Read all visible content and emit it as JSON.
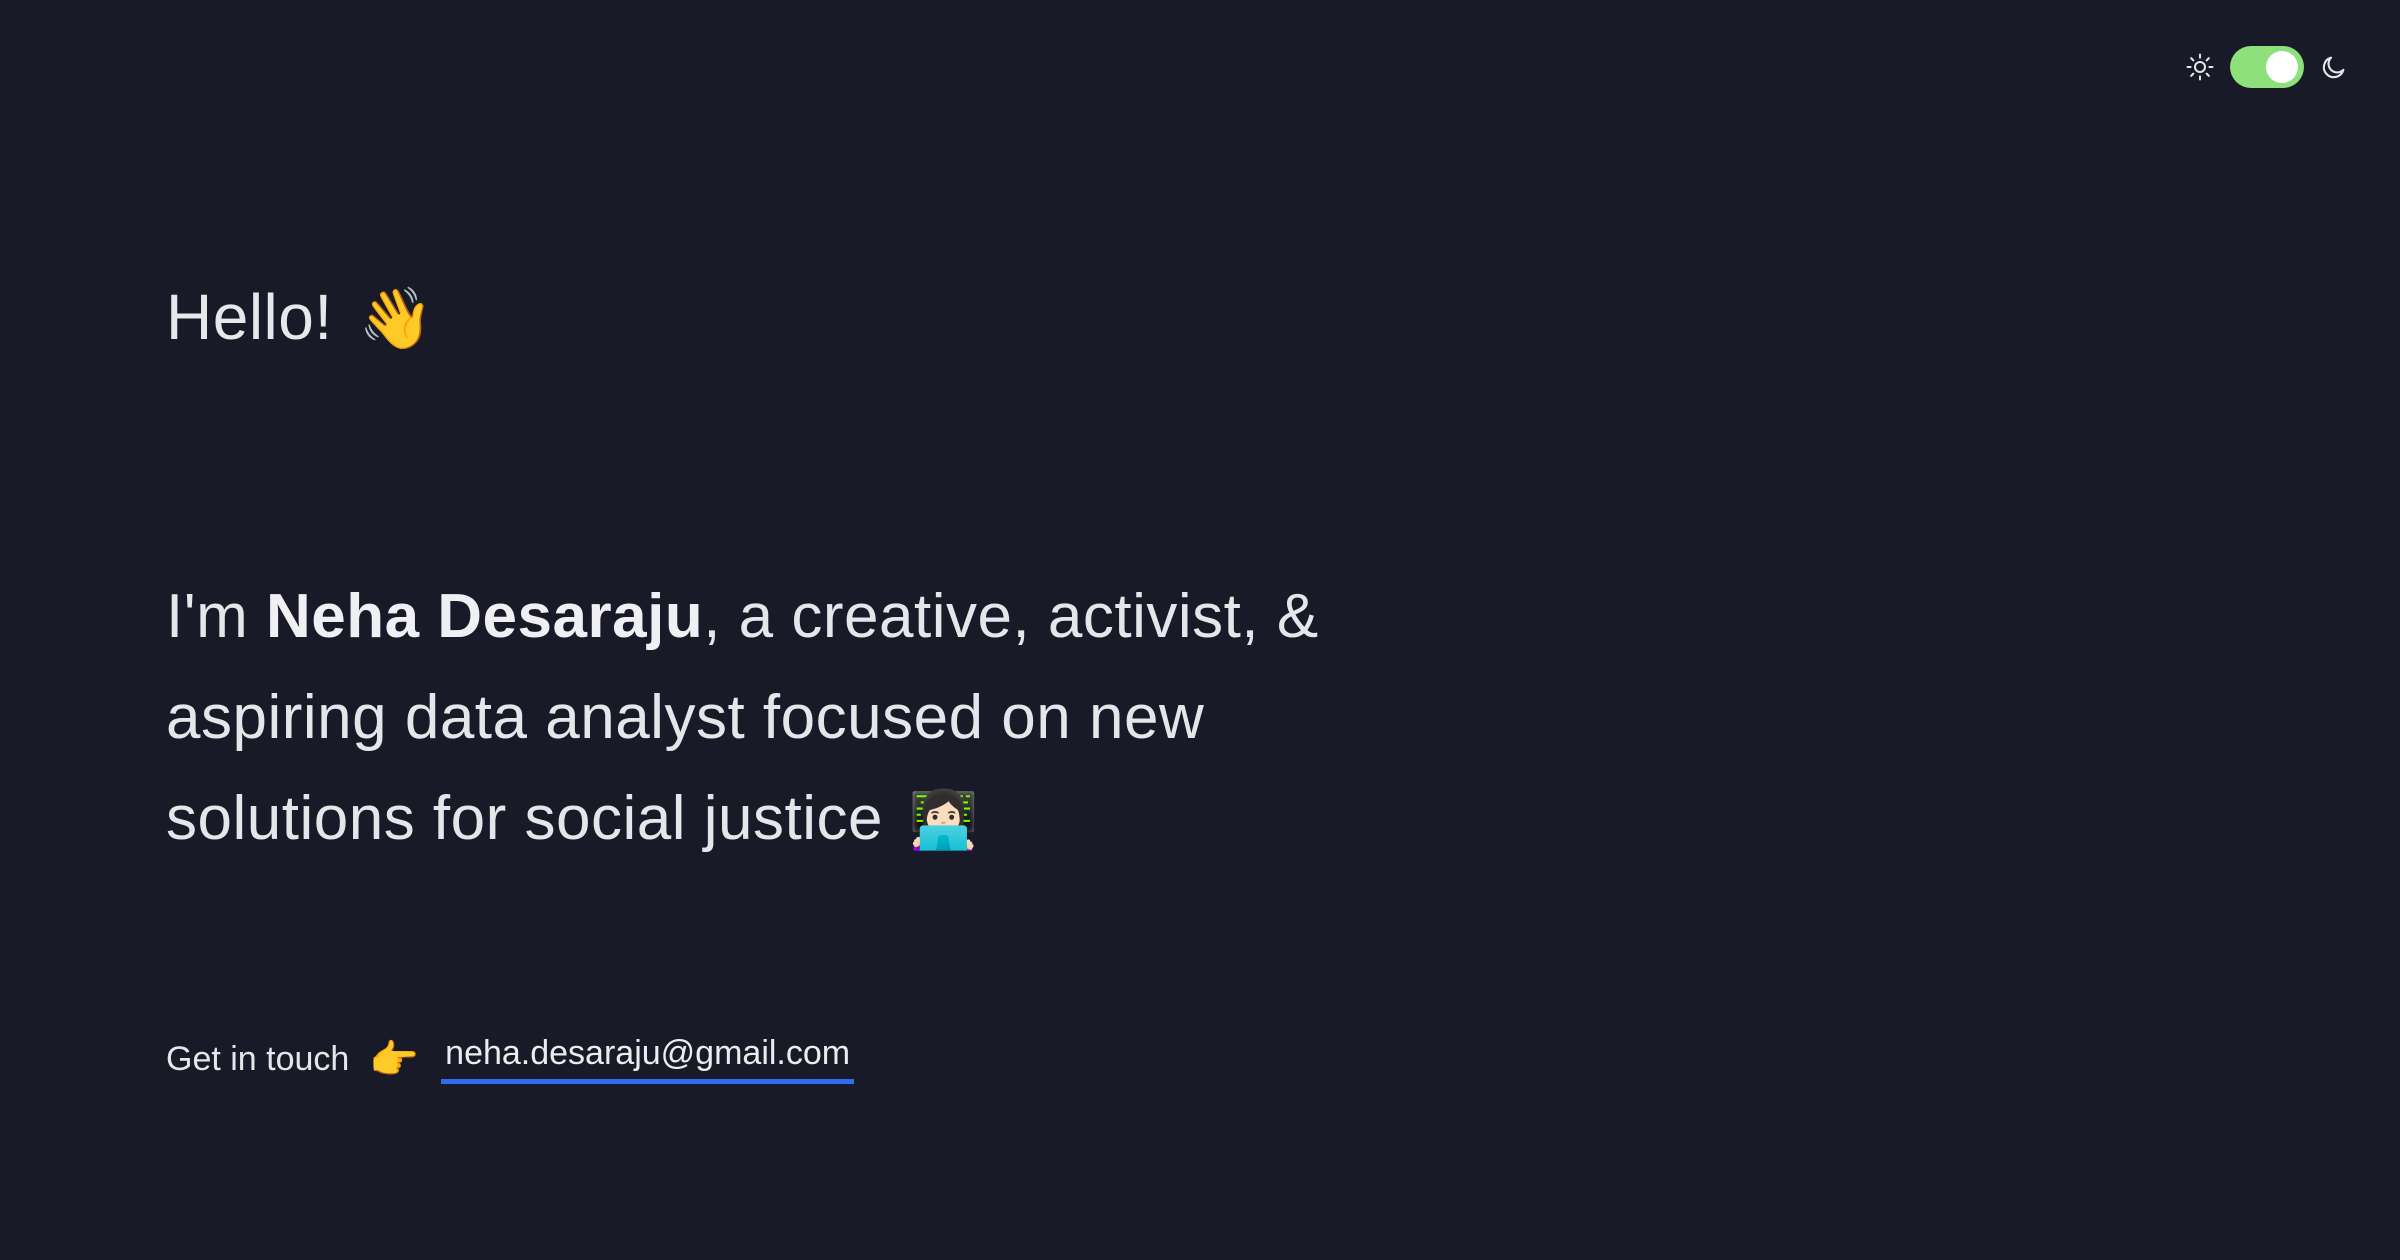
{
  "theme_toggle": {
    "light_icon": "sun-icon",
    "dark_icon": "moon-icon",
    "state": "dark",
    "track_color": "#8ee07a"
  },
  "greeting": {
    "text": "Hello!",
    "emoji": "👋"
  },
  "intro": {
    "prefix": "I'm ",
    "name": "Neha Desaraju",
    "suffix": ", a creative, activist, & aspiring data analyst focused on new solutions for social justice",
    "emoji": "👩🏻‍💻"
  },
  "contact": {
    "label": "Get in touch",
    "pointer_emoji": "👉",
    "email": "neha.desaraju@gmail.com",
    "link_underline_color": "#2d6bf0"
  },
  "colors": {
    "background": "#181b27",
    "text": "#e6e6ea"
  }
}
